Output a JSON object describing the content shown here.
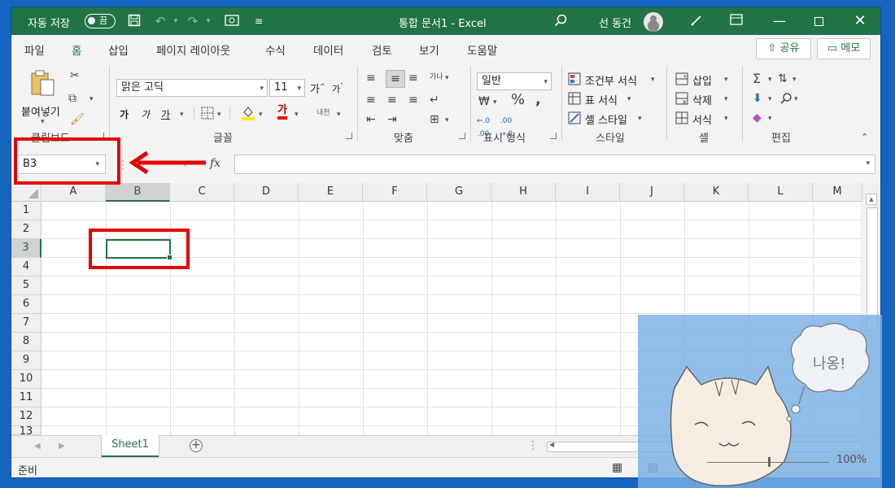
{
  "titlebar": {
    "autosave_label": "자동 저장",
    "autosave_state": "끔",
    "document_title": "통합 문서1  -  Excel",
    "user_name": "선 동건"
  },
  "menu": {
    "tabs": [
      "파일",
      "홈",
      "삽입",
      "페이지 레이아웃",
      "수식",
      "데이터",
      "검토",
      "보기",
      "도움말"
    ],
    "active_tab": "홈",
    "share_label": "공유",
    "comments_label": "메모"
  },
  "ribbon": {
    "clipboard": {
      "paste_label": "붙여넣기",
      "group_label": "클립보드"
    },
    "font": {
      "font_name": "맑은 고딕",
      "font_size": "11",
      "group_label": "글꼴",
      "bold": "가",
      "italic": "가",
      "underline": "가",
      "grow": "가",
      "shrink": "가",
      "phonetic": "내천"
    },
    "alignment": {
      "group_label": "맞춤",
      "wrap": "가나"
    },
    "number": {
      "format": "일반",
      "group_label": "표시 형식"
    },
    "styles": {
      "conditional": "조건부 서식",
      "table": "표 서식",
      "cell": "셀 스타일",
      "group_label": "스타일"
    },
    "cells": {
      "insert": "삽입",
      "delete": "삭제",
      "format": "서식",
      "group_label": "셀"
    },
    "editing": {
      "group_label": "편집"
    }
  },
  "formula_bar": {
    "name_box": "B3",
    "fx": "fx",
    "content": ""
  },
  "grid": {
    "columns": [
      "A",
      "B",
      "C",
      "D",
      "E",
      "F",
      "G",
      "H",
      "I",
      "J",
      "K",
      "L",
      "M"
    ],
    "rows": [
      "1",
      "2",
      "3",
      "4",
      "5",
      "6",
      "7",
      "8",
      "9",
      "10",
      "11",
      "12",
      "13"
    ],
    "selected_cell": "B3"
  },
  "sheets": {
    "tabs": [
      "Sheet1"
    ],
    "active": "Sheet1"
  },
  "status": {
    "text": "준비",
    "zoom": "100%"
  },
  "overlay": {
    "speech": "나옹!"
  },
  "colors": {
    "excel_green": "#217346",
    "annotation_red": "#e50000",
    "desktop_blue": "#1565c0"
  }
}
